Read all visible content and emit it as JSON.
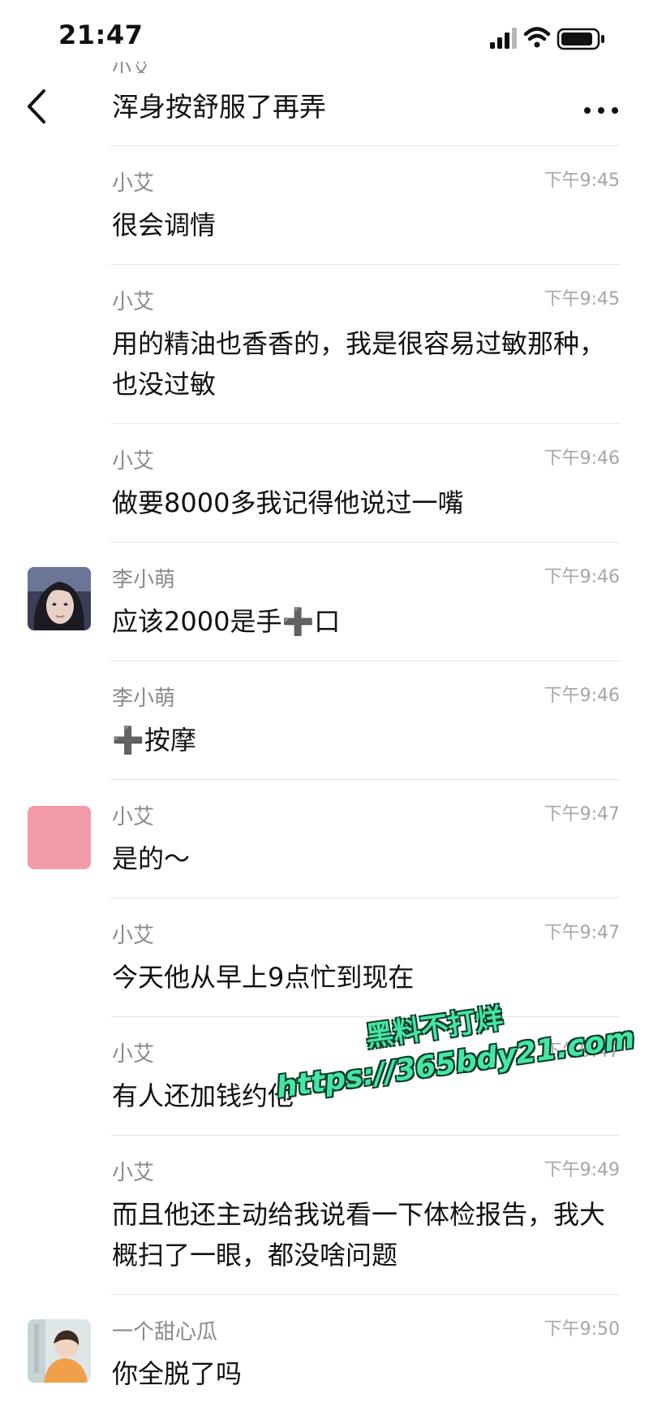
{
  "status_bar": {
    "time": "21:47",
    "icons": [
      "signal-icon",
      "wifi-icon",
      "battery-icon"
    ]
  },
  "header": {
    "partial_previous_sender": "小艾",
    "title": "浑身按舒服了再弄"
  },
  "messages": [
    {
      "sender": "小艾",
      "time": "下午9:45",
      "text": "很会调情"
    },
    {
      "sender": "小艾",
      "time": "下午9:45",
      "text": "用的精油也香香的，我是很容易过敏那种，也没过敏"
    },
    {
      "sender": "小艾",
      "time": "下午9:46",
      "text": "做要8000多我记得他说过一嘴"
    },
    {
      "sender": "李小萌",
      "time": "下午9:46",
      "text": "应该2000是手➕口"
    },
    {
      "sender": "李小萌",
      "time": "下午9:46",
      "text": "➕按摩"
    },
    {
      "sender": "小艾",
      "time": "下午9:47",
      "text": "是的～"
    },
    {
      "sender": "小艾",
      "time": "下午9:47",
      "text": "今天他从早上9点忙到现在"
    },
    {
      "sender": "小艾",
      "time": "下午9:47",
      "text": "有人还加钱约他"
    },
    {
      "sender": "小艾",
      "time": "下午9:49",
      "text": "而且他还主动给我说看一下体检报告，我大概扫了一眼，都没啥问题"
    },
    {
      "sender": "一个甜心瓜",
      "time": "下午9:50",
      "text": "你全脱了吗"
    }
  ],
  "watermark": {
    "line1": "黑料不打烊",
    "line2": "https://365bdy21.com"
  },
  "colors": {
    "avatar_pink": "#f29aa8",
    "watermark_green": "#45e6a3"
  }
}
